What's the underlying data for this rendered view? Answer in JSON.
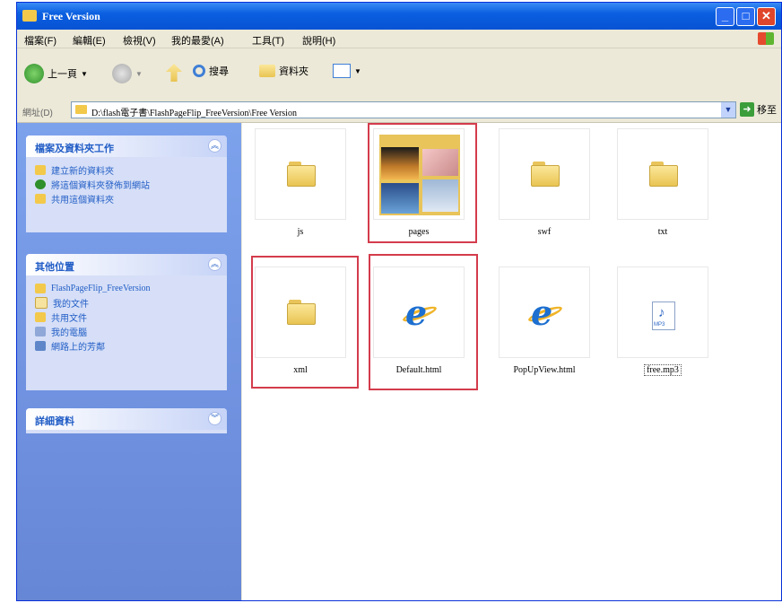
{
  "window": {
    "title": "Free Version",
    "minimize": "_",
    "maximize": "□",
    "close": "✕"
  },
  "menu": [
    "檔案(F)",
    "編輯(E)",
    "檢視(V)",
    "我的最愛(A)",
    "工具(T)",
    "說明(H)"
  ],
  "toolbar": {
    "back": "上一頁",
    "search": "搜尋",
    "folders": "資料夾"
  },
  "address": {
    "label": "網址(D)",
    "path": "D:\\flash電子書\\FlashPageFlip_FreeVersion\\Free Version",
    "go": "移至"
  },
  "sidebar": {
    "tasks": {
      "title": "檔案及資料夾工作",
      "items": [
        "建立新的資料夾",
        "將這個資料夾發佈到網站",
        "共用這個資料夾"
      ]
    },
    "places": {
      "title": "其他位置",
      "items": [
        "FlashPageFlip_FreeVersion",
        "我的文件",
        "共用文件",
        "我的電腦",
        "網路上的芳鄰"
      ]
    },
    "details": {
      "title": "詳細資料"
    }
  },
  "files": [
    {
      "name": "js",
      "type": "folder",
      "highlighted": false
    },
    {
      "name": "pages",
      "type": "folder-thumbnails",
      "highlighted": true
    },
    {
      "name": "swf",
      "type": "folder",
      "highlighted": false
    },
    {
      "name": "txt",
      "type": "folder",
      "highlighted": false
    },
    {
      "name": "xml",
      "type": "folder",
      "highlighted": true
    },
    {
      "name": "Default.html",
      "type": "html",
      "highlighted": true
    },
    {
      "name": "PopUpView.html",
      "type": "html",
      "highlighted": false
    },
    {
      "name": "free.mp3",
      "type": "mp3",
      "highlighted": false
    }
  ],
  "colors": {
    "titlebar": "#0a5fe0",
    "sidepane": "#6f8fdd",
    "highlight": "#d43c4c"
  }
}
